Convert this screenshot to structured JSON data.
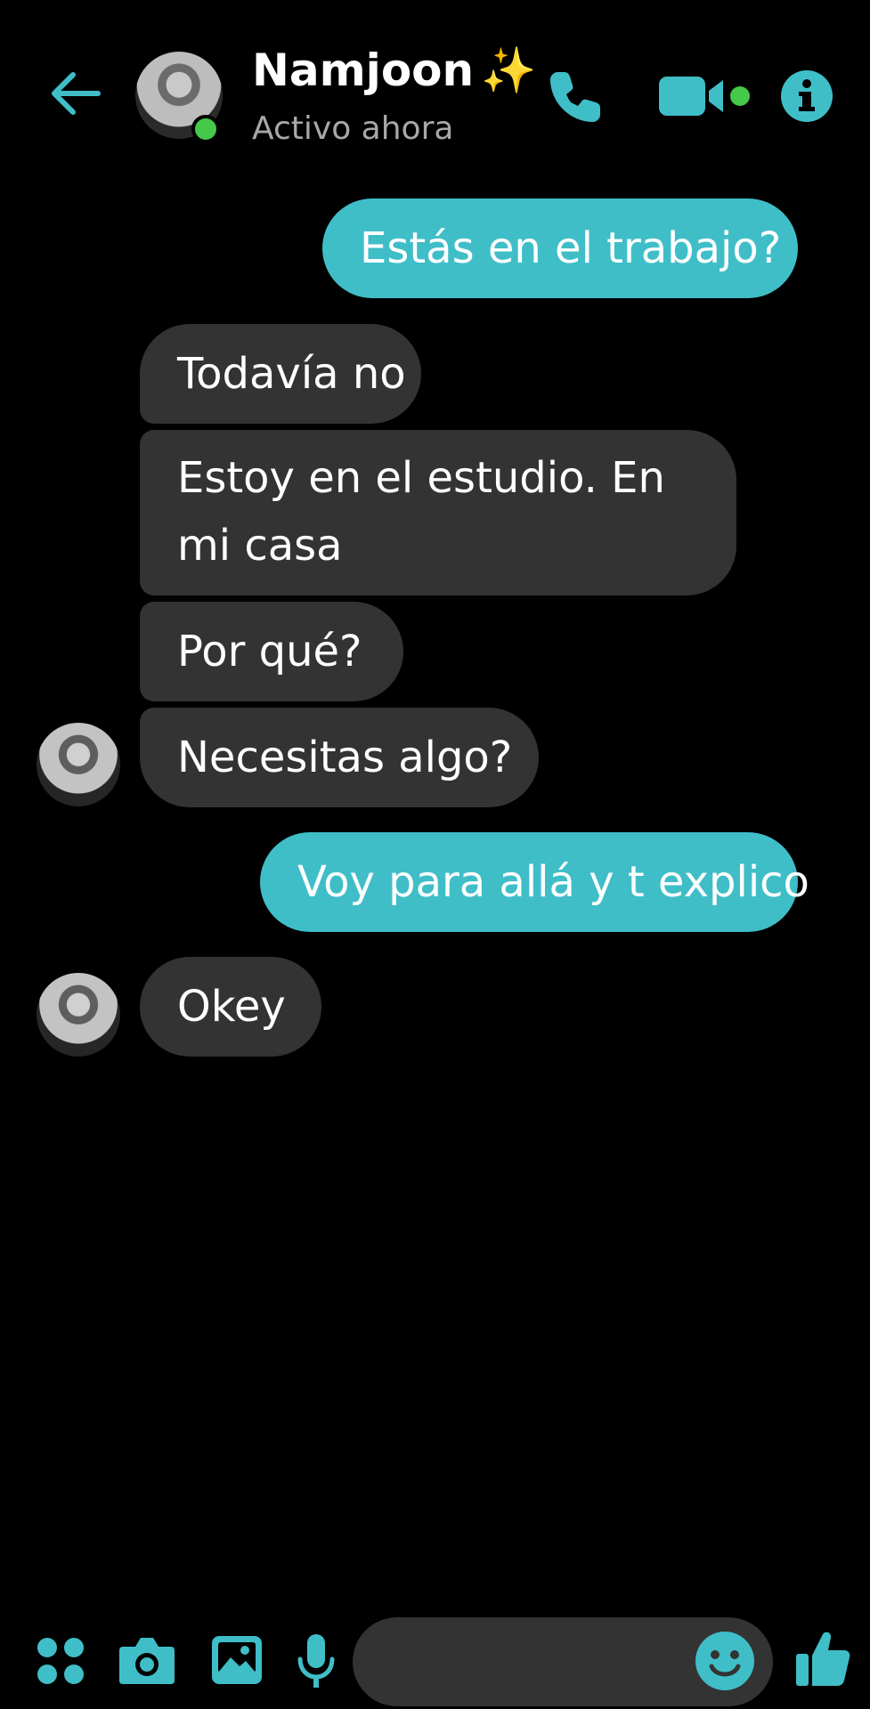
{
  "header": {
    "contact_name": "Namjoon",
    "sparkle": "✨",
    "status": "Activo ahora"
  },
  "messages": [
    {
      "side": "out",
      "text": "Estás en el trabajo?"
    },
    {
      "side": "in",
      "text": "Todavía no"
    },
    {
      "side": "in",
      "text": "Estoy en el estudio. En mi casa"
    },
    {
      "side": "in",
      "text": "Por qué?"
    },
    {
      "side": "in",
      "text": "Necesitas algo?"
    },
    {
      "side": "out",
      "text": "Voy para allá y t explico"
    },
    {
      "side": "in",
      "text": "Okey"
    }
  ],
  "composer": {
    "value": "",
    "placeholder": ""
  },
  "colors": {
    "accent": "#3fbec8",
    "incoming_bubble": "#333333",
    "background": "#000000",
    "online": "#44c94a",
    "status_text": "#a8a8a8"
  },
  "icons": {
    "back": "arrow-left-icon",
    "call": "phone-icon",
    "video": "video-camera-icon",
    "info": "info-icon",
    "apps": "four-dots-icon",
    "camera": "camera-icon",
    "gallery": "image-icon",
    "mic": "microphone-icon",
    "emoji": "smiley-icon",
    "like": "thumbs-up-icon"
  }
}
